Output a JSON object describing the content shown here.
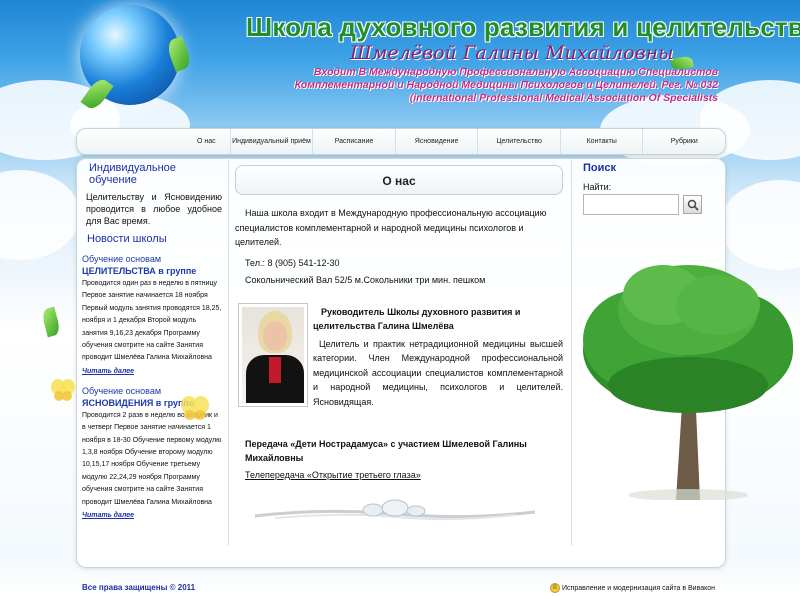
{
  "header": {
    "title": "Школа духовного развития и целительства",
    "name": "Шмелёвой Галины Михайловны",
    "subtitle": "Входит В Международную Профессиональную Ассоциацию Специалистов Комплементарной и Народной Медицины Психологов и Целителей. Рег. № 032 (international Professional Medical Association Of Specialists"
  },
  "nav": {
    "items": [
      {
        "label": "О нас"
      },
      {
        "label": "Индивидуальный приём"
      },
      {
        "label": "Расписание"
      },
      {
        "label": "Ясновидение"
      },
      {
        "label": "Целительство"
      },
      {
        "label": "Контакты"
      },
      {
        "label": "Рубрики"
      }
    ]
  },
  "left": {
    "intro_title": "Индивидуальное обучение",
    "intro_text": "Целительству и Ясновидению проводится в любое удобное для Вас время.",
    "news_title": "Новости школы",
    "news": [
      {
        "head_1": "Обучение основам",
        "head_2": "ЦЕЛИТЕЛЬСТВА в группе",
        "body": "Проводится один раз в неделю в пятницу Первое занятие начинается 18 ноября Первый модуль занятия проводятся 18,25, ноября и 1 декабря Второй модуль занятия 9,16,23 декабря Программу обучения смотрите на сайте Занятия проводит Шмелёва Галина Михайловна",
        "more": "Читать далее"
      },
      {
        "head_1": "Обучение основам",
        "head_2": "ЯСНОВИДЕНИЯ в группе",
        "body": "Проводится 2 разв в неделю во вторник и в четверг Первое занятие начинается 1 ноября в 18-30 Обучение первому модулю 1,3,8 ноября Обучение второму модулю 10,15,17 ноября Обучение третьему модулю 22,24,29 ноября Программу обучения смотрите на сайте Занятия проводит Шмелёва Галина Михайловна",
        "more": "Читать далее"
      }
    ]
  },
  "main": {
    "title": "О нас",
    "intro": "Наша школа входит в Международную профессиональную ассоциацию специалистов комплементарной и народной медицины психологов и целителей.",
    "phone": "Тел.: 8 (905) 541-12-30",
    "address": "Сокольнический Вал 52/5 м.Сокольники три мин. пешком",
    "person_title": "Руководитель Школы духовного развития и целительства Галина Шмелёва",
    "person_text": "Целитель и практик нетрадиционной медицины высшей категории. Член Международной профессиональной медицинской ассоциации специалистов комплементарной и народной медицины, психологов и целителей. Ясновидящая.",
    "tv_title": "Передача «Дети Нострадамуса» с участием Шмелевой Галины Михайловны",
    "tv_link": "Телепередача «Открытие третьего глаза»"
  },
  "right": {
    "search_title": "Поиск",
    "search_label": "Найти:",
    "search_value": ""
  },
  "footer": {
    "copyright": "Все права защищены © 2011",
    "credit": "Исправление и модернизация сайта в Вивакон",
    "badge": "В"
  },
  "colors": {
    "accent_blue": "#1c2fa6",
    "title_green": "#1f8f2c",
    "subtitle_magenta": "#c22a86",
    "name_purple": "#8c1f6e"
  }
}
